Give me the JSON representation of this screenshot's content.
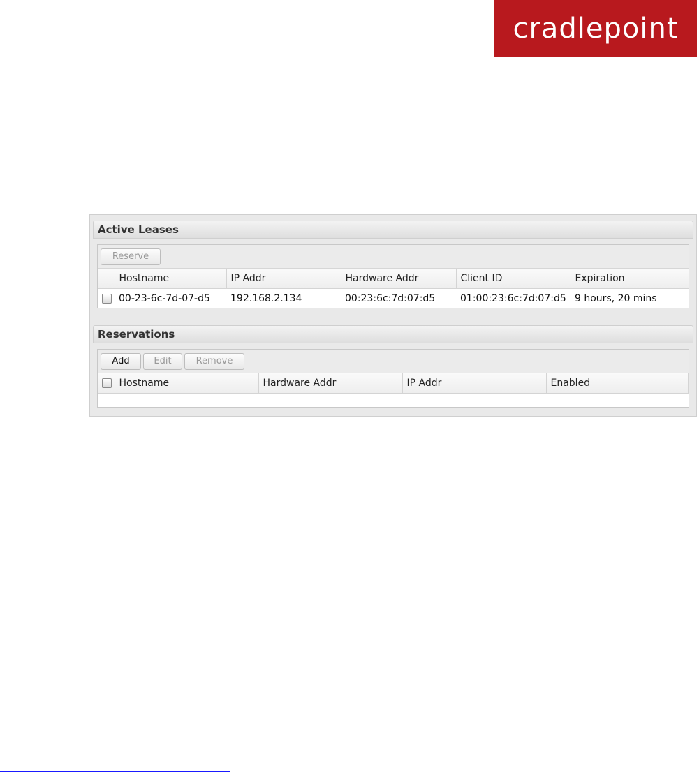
{
  "brand": {
    "logo_text": "cradlepoint",
    "logo_color": "#b8191e"
  },
  "active_leases": {
    "title": "Active Leases",
    "toolbar": {
      "reserve_label": "Reserve"
    },
    "columns": [
      "Hostname",
      "IP Addr",
      "Hardware Addr",
      "Client ID",
      "Expiration"
    ],
    "rows": [
      {
        "hostname": "00-23-6c-7d-07-d5",
        "ip": "192.168.2.134",
        "hardware": "00:23:6c:7d:07:d5",
        "client_id": "01:00:23:6c:7d:07:d5",
        "expiration": "9 hours, 20 mins"
      }
    ]
  },
  "reservations": {
    "title": "Reservations",
    "toolbar": {
      "add_label": "Add",
      "edit_label": "Edit",
      "remove_label": "Remove"
    },
    "columns": [
      "Hostname",
      "Hardware Addr",
      "IP Addr",
      "Enabled"
    ]
  }
}
